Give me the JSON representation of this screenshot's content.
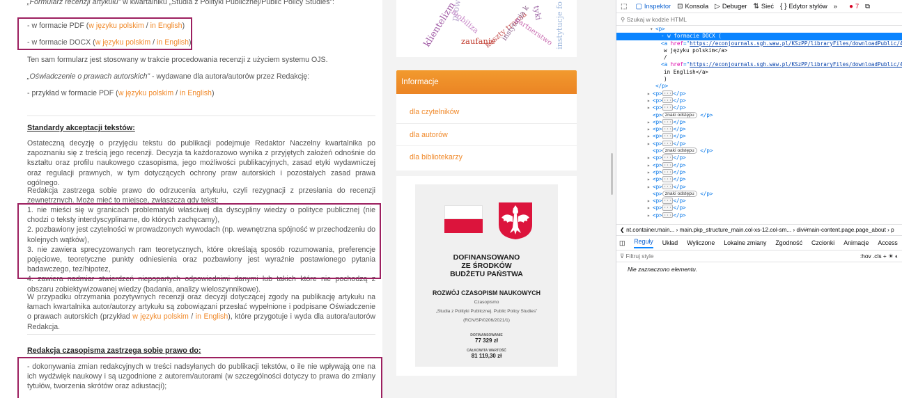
{
  "article": {
    "top_line": {
      "quote": "„Formularz recenzji artykułu”",
      "rest": " w kwartalniku „Studia z Polityki Publicznej/Public Policy Studies”:"
    },
    "pdf_line": {
      "prefix": "- w formacie PDF (",
      "link_pl": "w języku polskim",
      "sep": " / ",
      "link_en": "in English",
      "suffix": ")"
    },
    "docx_line": {
      "prefix": "- w formacie DOCX (",
      "link_pl": "w języku polskim",
      "sep": " / ",
      "link_en": "in English",
      "suffix": ")"
    },
    "ojs_note": "Ten sam formularz jest stosowany w trakcie procedowania recenzji z użyciem systemu OJS.",
    "statement": {
      "quote": "„Oświadczenie o prawach autorskich”",
      "rest": " - wydawane dla autora/autorów przez Redakcję:"
    },
    "example_line": {
      "prefix": "- przykład w formacie PDF (",
      "link_pl": "w języku polskim",
      "sep": " / ",
      "link_en": "in English",
      "suffix": ")"
    },
    "standards_heading": "Standardy akceptacji tekstów:",
    "standards_paragraph": "Ostateczną decyzję o przyjęciu tekstu do publikacji podejmuje Redaktor Naczelny kwartalnika po zapoznaniu się z treścią jego recenzji. Decyzja ta każdorazowo wynika z przyjętych założeń odnośnie do kształtu oraz profilu naukowego czasopisma, jego możliwości publikacyjnych, zasad etyki wydawniczej oraz regulacji prawnych, w tym dotyczących ochrony praw autorskich i pozostałych zasad prawa ogólnego.",
    "rejection_paragraph": "Redakcja zastrzega sobie prawo do odrzucenia artykułu, czyli rezygnacji z przesłania do recenzji zewnętrznych. Może mieć to miejsce, zwłaszcza gdy tekst:",
    "reasons": [
      "1. nie mieści się w granicach problematyki właściwej dla dyscypliny wiedzy o polityce publicznej (nie chodzi o teksty interdyscyplinarne, do których zachęcamy),",
      "2. pozbawiony jest czytelności w prowadzonych wywodach (np. wewnętrzna spójność w przechodzeniu do kolejnych wątków),",
      "3. nie zawiera sprecyzowanych ram teoretycznych, które określają sposób rozumowania, preferencje pojęciowe, teoretyczne punkty odniesienia oraz pozbawiony jest wyraźnie postawionego pytania badawczego, tez/hipotez,",
      "4. zawiera nadmiar stwierdzeń niepopartych odpowiednimi danymi lub takich które nie pochodzą z obszaru zobiektywizowanej wiedzy (badania, analizy wieloszynnikowe)."
    ],
    "positive_paragraph": {
      "text": "W przypadku otrzymania pozytywnych recenzji oraz decyzji dotyczącej zgody na publikację artykułu na łamach kwartalnika autor/autorzy artykułu są zobowiązani przesłać wypełnione i podpisane Oświadczenie o prawach autorskich (przykład ",
      "link_pl": "w języku polskim",
      "sep": " / ",
      "link_en": "in English",
      "tail": "), które przygotuje i wyda dla autora/autorów Redakcja."
    },
    "rights_heading": "Redakcja czasopisma zastrzega sobie prawo do:",
    "rights_paragraph": "- dokonywania zmian redakcyjnych w treści nadsyłanych do publikacji tekstów, o ile nie wpływają one na ich wydźwięk naukowy i są uzgodnione z autorem/autorami (w szczególności dotyczy to prawa do zmiany tytułów, tworzenia skrótów oraz adiustacji);"
  },
  "sidebar": {
    "keyword_cloud": [
      "klientelizm",
      "prow",
      "mobiliza",
      "zaufanie",
      "koszty transa",
      "instytucja k",
      "partnerstwo",
      "tyki",
      "instytucje fo"
    ],
    "info": {
      "title": "Informacje",
      "links": [
        "dla czytelników",
        "dla autorów",
        "dla bibliotekarzy"
      ]
    },
    "banner": {
      "line1": "DOFINANSOWANO",
      "line2": "ZE ŚRODKÓW",
      "line3": "BUDŻETU PAŃSTWA",
      "program": "ROZWÓJ CZASOPISM NAUKOWYCH",
      "journal_label": "Czasopismo",
      "journal_name": "„Studia z Polityki Publicznej. Public Policy Studies”",
      "contract": "(RCN/SP/0206/2021/1)",
      "funding_label": "DOFINANSOWANIE",
      "funding_value": "77 329 zł",
      "total_label": "CAŁKOWITA WARTOŚĆ",
      "total_value": "81 119,30 zł"
    }
  },
  "devtools": {
    "tabs": [
      "Inspektor",
      "Konsola",
      "Debuger",
      "Sieć",
      "Edytor stylów"
    ],
    "more": "»",
    "error_count": "7",
    "search_placeholder": "Szukaj w kodzie HTML",
    "tree": {
      "open_p": "<p>",
      "selected_text": "- w formacie DOCX (",
      "a1_href": "https://econjournals.sgh.waw.pl/KSzPP/libraryFiles/downloadPublic/40",
      "a1_text": "w języku polskim</a>",
      "slash": "/",
      "a2_href": "https://econjournals.sgh.waw.pl/KSzPP/libraryFiles/downloadPublic/42",
      "a2_text": "in English</a>",
      "close_paren": ")",
      "close_p": "</p>",
      "whitespace_label": "znaki odstępu"
    },
    "breadcrumb": "nt.container.main... › main.pkp_structure_main.col-xs-12.col-sm... › div#main-content.page.page_about › p",
    "rules_tabs": [
      "Reguły",
      "Układ",
      "Wyliczone",
      "Lokalne zmiany",
      "Zgodność",
      "Czcionki",
      "Animacje",
      "Access"
    ],
    "filter_placeholder": "Filtruj style",
    "filter_tools": ":hov  .cls  +  ☀  ◐",
    "empty_message": "Nie zaznaczono elementu."
  }
}
